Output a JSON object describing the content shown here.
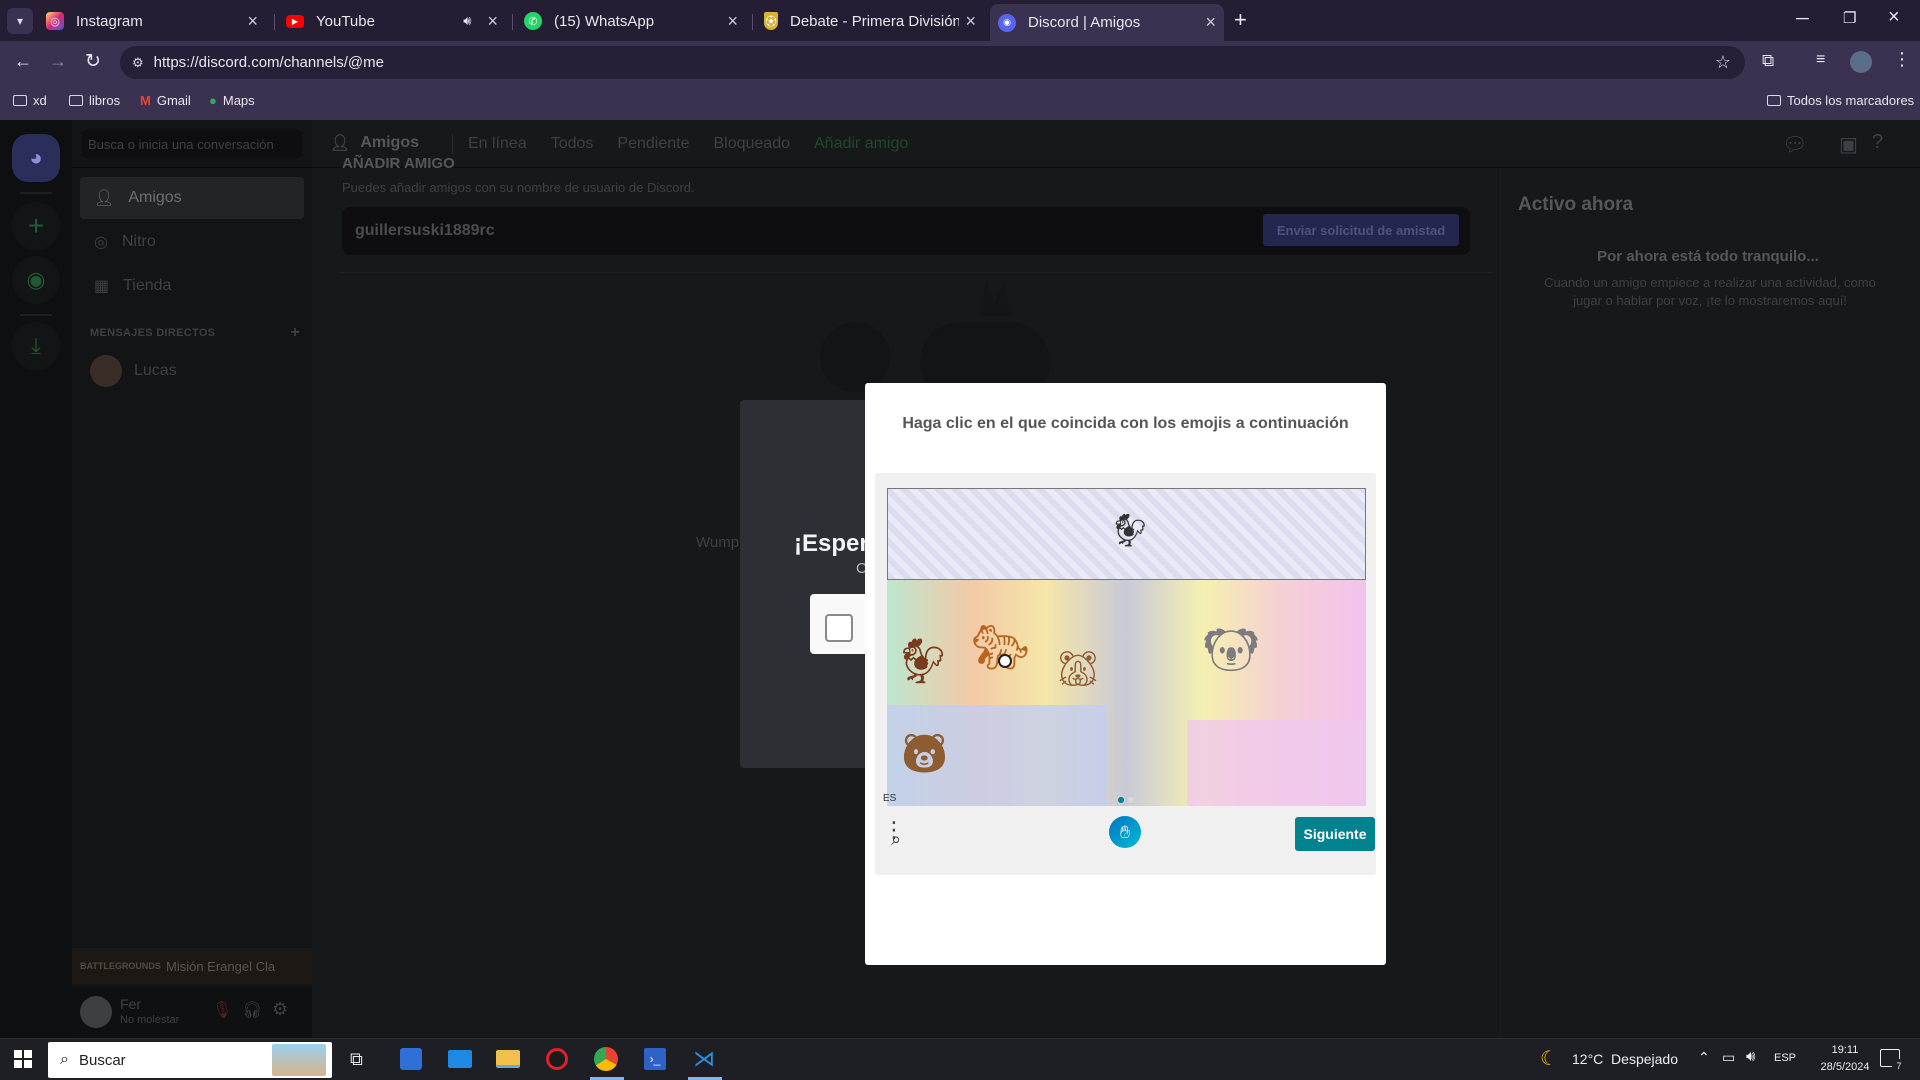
{
  "browser": {
    "tabs": [
      {
        "title": "Instagram",
        "icon": "instagram-icon",
        "color": "#e1306c"
      },
      {
        "title": "YouTube",
        "icon": "youtube-icon",
        "color": "#ff0000"
      },
      {
        "title": "(15) WhatsApp",
        "icon": "whatsapp-icon",
        "color": "#25d366"
      },
      {
        "title": "Debate - Primera División de Ar",
        "icon": "shield-icon",
        "color": "#d9b232"
      },
      {
        "title": "Discord | Amigos",
        "icon": "discord-icon",
        "color": "#5865f2"
      }
    ],
    "url": "https://discord.com/channels/@me",
    "bookmarks": [
      {
        "label": "xd",
        "icon": "folder-icon"
      },
      {
        "label": "libros",
        "icon": "folder-icon"
      },
      {
        "label": "Gmail",
        "icon": "gmail-icon"
      },
      {
        "label": "Maps",
        "icon": "maps-icon"
      }
    ],
    "all_bookmarks": "Todos los marcadores"
  },
  "discord": {
    "search_placeholder": "Busca o inicia una conversación",
    "nav": [
      {
        "label": "Amigos",
        "icon": "friends-icon"
      },
      {
        "label": "Nitro",
        "icon": "nitro-icon"
      },
      {
        "label": "Tienda",
        "icon": "shop-icon"
      }
    ],
    "dm_header": "MENSAJES DIRECTOS",
    "dms": [
      {
        "name": "Lucas"
      }
    ],
    "header_title": "Amigos",
    "header_tabs": [
      "En línea",
      "Todos",
      "Pendiente",
      "Bloqueado"
    ],
    "add_friend_tab": "Añadir amigo",
    "add_title": "AÑADIR AMIGO",
    "add_desc": "Puedes añadir amigos con su nombre de usuario de Discord.",
    "add_input_value": "guillersuski1889rc",
    "add_button": "Enviar solicitud de amistad",
    "wumpus_text": "Wump",
    "active_title": "Activo ahora",
    "active_empty_title": "Por ahora está todo tranquilo...",
    "active_empty_desc": "Cuando un amigo empiece a realizar una actividad, como jugar o hablar por voz, ¡te lo mostraremos aquí!",
    "game_activity": "Misión Erangel Cla",
    "game_logo_text": "BATTLEGROUNDS",
    "user_name": "Fer",
    "user_status": "No molestar",
    "modal_title_partial": "¡Esper",
    "modal_sub_partial": "C"
  },
  "captcha": {
    "instruction": "Haga clic en el que coincida con los emojis a continuación",
    "language": "ES",
    "next_button": "Siguiente",
    "pagination": {
      "current": 1,
      "total": 2
    }
  },
  "taskbar": {
    "search_placeholder": "Buscar",
    "weather": "12°C  Despejado",
    "lang": "ESP",
    "time": "19:11",
    "date": "28/5/2024",
    "notifications": "7"
  }
}
